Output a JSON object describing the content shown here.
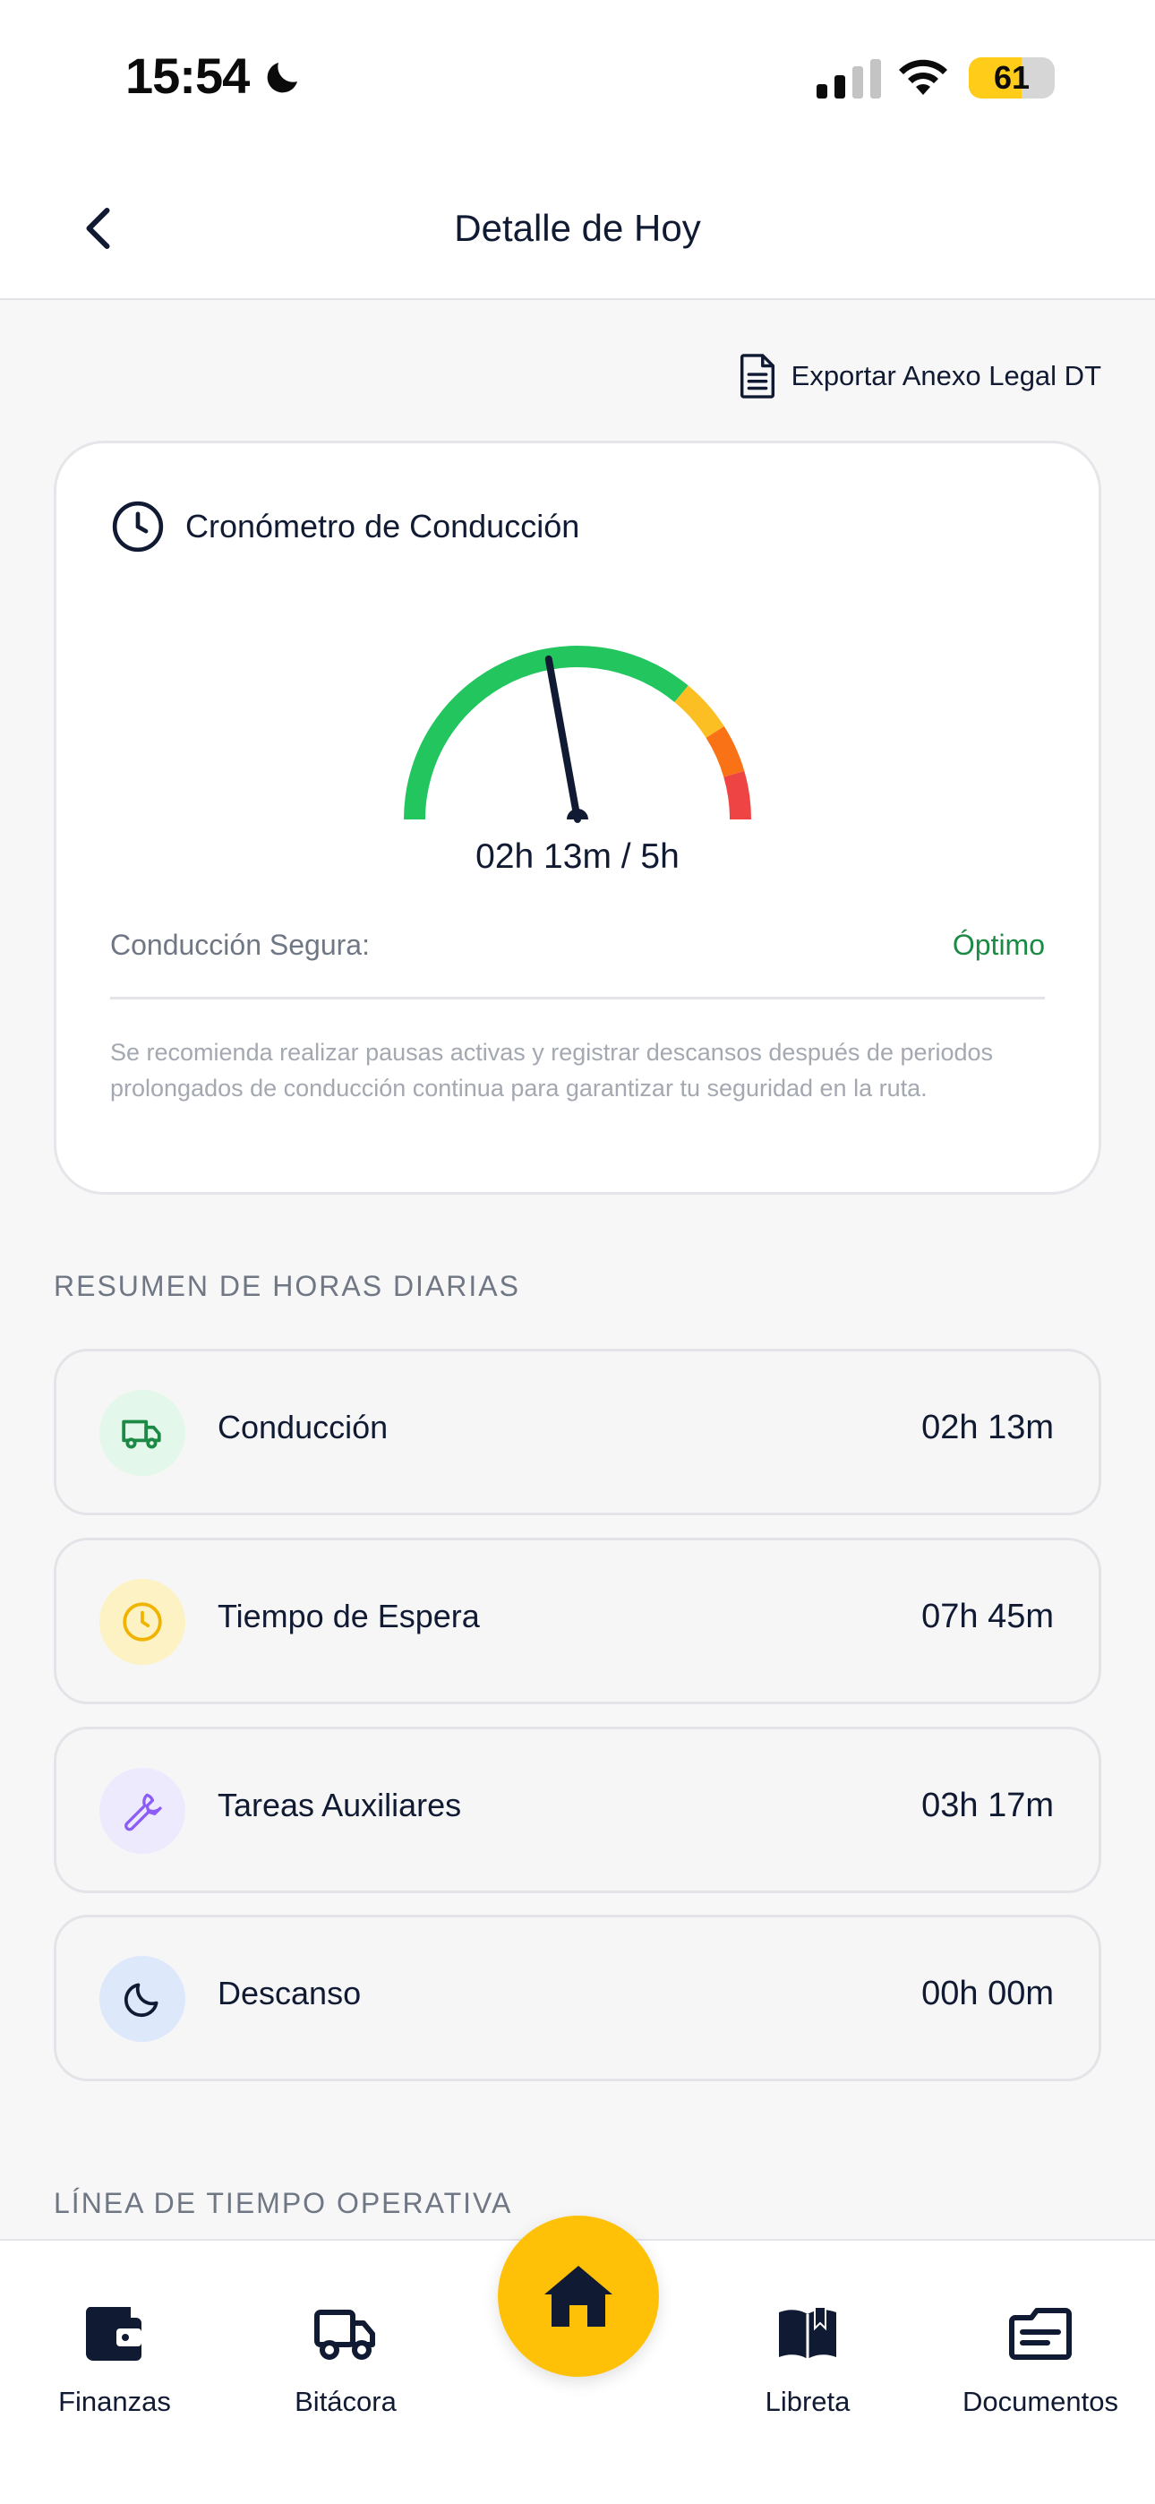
{
  "status_bar": {
    "time": "15:54",
    "battery": "61",
    "battery_level": 0.61,
    "icons": [
      "moon-icon",
      "signal-icon",
      "wifi-icon",
      "battery-icon"
    ]
  },
  "header": {
    "title": "Detalle de Hoy",
    "back_icon": "chevron-left-icon"
  },
  "export": {
    "label": "Exportar Anexo Legal DT",
    "icon": "document-icon"
  },
  "chronometer": {
    "title": "Cronómetro de Conducción",
    "icon": "clock-icon",
    "gauge_text": "02h 13m / 5h",
    "gauge_fraction": 0.4433,
    "gauge_colors": [
      "#22c55e",
      "#fbbf24",
      "#f97316",
      "#ef4444"
    ],
    "safe_label": "Conducción Segura:",
    "safe_value": "Óptimo",
    "note": "Se recomienda realizar pausas activas y registrar descansos después de periodos prolongados de conducción continua para garantizar tu seguridad en la ruta."
  },
  "summary": {
    "title": "RESUMEN DE HORAS DIARIAS",
    "rows": [
      {
        "label": "Conducción",
        "value": "02h 13m",
        "icon": "truck-icon",
        "icon_bg": "#e3f7ea",
        "icon_color": "#1c8a45"
      },
      {
        "label": "Tiempo de Espera",
        "value": "07h 45m",
        "icon": "clock-icon",
        "icon_bg": "#fdf2c4",
        "icon_color": "#f0b400"
      },
      {
        "label": "Tareas Auxiliares",
        "value": "03h 17m",
        "icon": "wrench-icon",
        "icon_bg": "#eeeafd",
        "icon_color": "#8b5cf6"
      },
      {
        "label": "Descanso",
        "value": "00h 00m",
        "icon": "moon-icon",
        "icon_bg": "#dde9fb",
        "icon_color": "#111a33"
      }
    ]
  },
  "timeline": {
    "title": "LÍNEA DE TIEMPO OPERATIVA"
  },
  "nav": {
    "items": [
      {
        "label": "Finanzas",
        "icon": "wallet-icon"
      },
      {
        "label": "Bitácora",
        "icon": "truck-icon"
      },
      {
        "label": "Libreta",
        "icon": "book-icon"
      },
      {
        "label": "Documentos",
        "icon": "documents-icon"
      }
    ],
    "home_icon": "home-icon",
    "accent": "#ffc107"
  }
}
